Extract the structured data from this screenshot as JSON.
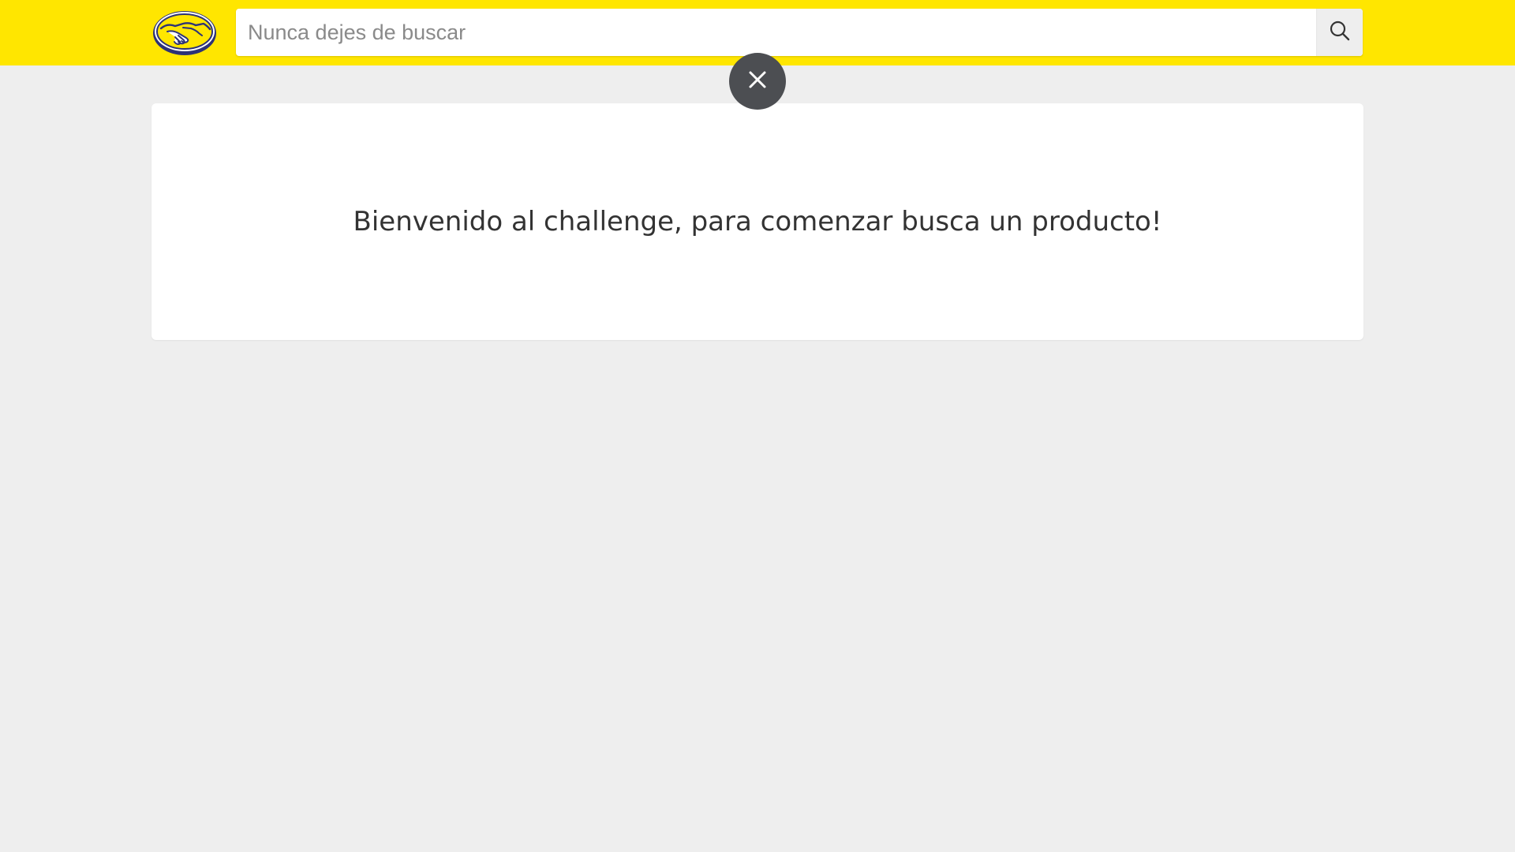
{
  "header": {
    "background_color": "#ffe600",
    "logo_icon": "handshake-logo-icon",
    "search": {
      "placeholder": "Nunca dejes de buscar",
      "value": "",
      "button_icon": "search-icon"
    }
  },
  "overlay": {
    "close_icon": "close-icon"
  },
  "main": {
    "welcome_message": "Bienvenido al challenge, para comenzar busca un producto!"
  },
  "colors": {
    "accent": "#3483fa",
    "page_background": "#eeeeee",
    "close_button": "#4c4e52"
  }
}
